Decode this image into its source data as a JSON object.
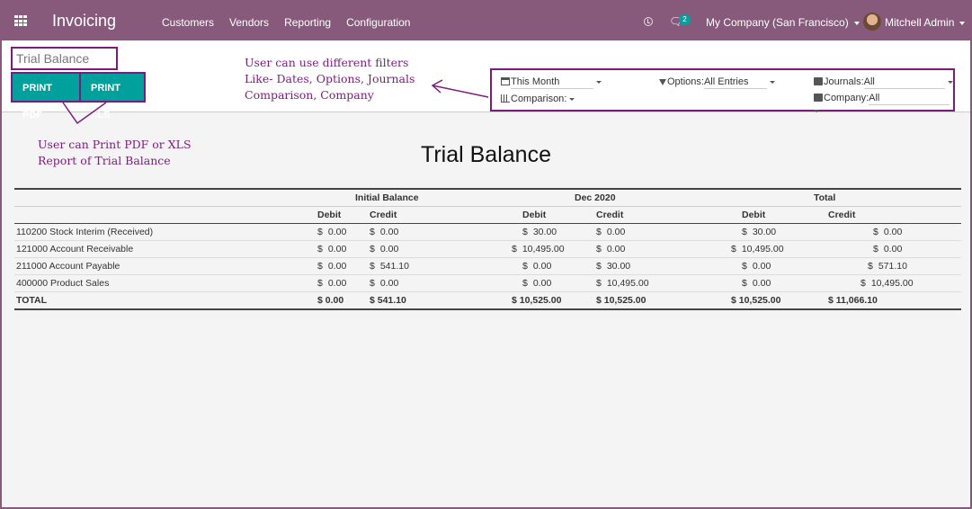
{
  "navbar": {
    "app_name": "Invoicing",
    "menu": [
      "Customers",
      "Vendors",
      "Reporting",
      "Configuration"
    ],
    "chat_badge": "2",
    "company": "My Company (San Francisco)",
    "user": "Mitchell Admin"
  },
  "control_panel": {
    "breadcrumb": "Trial Balance",
    "print_pdf_label": "PRINT PDF",
    "print_xls_label": "PRINT XLS",
    "filters": {
      "date": "This Month",
      "comparison": "Comparison:",
      "options_label": "Options:",
      "options_value": "All Entries",
      "journals_label": "Journals:",
      "journals_value": "All",
      "company_label": "Company:",
      "company_value": "All"
    }
  },
  "annotations": {
    "filters_line1": "User can use different filters",
    "filters_line2": "Like- Dates, Options, Journals",
    "filters_line3": "Comparison, Company",
    "print_line1": "User can Print PDF or XLS",
    "print_line2": "Report of Trial Balance"
  },
  "report": {
    "title": "Trial Balance",
    "groups": [
      "Initial Balance",
      "Dec 2020",
      "Total"
    ],
    "debit_label": "Debit",
    "credit_label": "Credit",
    "currency": "$",
    "rows": [
      {
        "account": "110200 Stock Interim (Received)",
        "values": [
          "0.00",
          "0.00",
          "30.00",
          "0.00",
          "30.00",
          "0.00"
        ]
      },
      {
        "account": "121000 Account Receivable",
        "values": [
          "0.00",
          "0.00",
          "10,495.00",
          "0.00",
          "10,495.00",
          "0.00"
        ]
      },
      {
        "account": "211000 Account Payable",
        "values": [
          "0.00",
          "541.10",
          "0.00",
          "30.00",
          "0.00",
          "571.10"
        ]
      },
      {
        "account": "400000 Product Sales",
        "values": [
          "0.00",
          "0.00",
          "0.00",
          "10,495.00",
          "0.00",
          "10,495.00"
        ]
      }
    ],
    "total": {
      "label": "TOTAL",
      "values": [
        "$ 0.00",
        "$ 541.10",
        "$ 10,525.00",
        "$ 10,525.00",
        "$ 10,525.00",
        "$ 11,066.10"
      ]
    }
  }
}
